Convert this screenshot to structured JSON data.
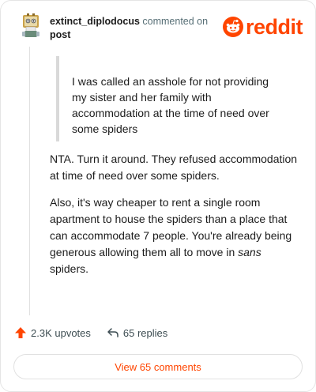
{
  "header": {
    "username": "extinct_diplodocus",
    "action": "commented on",
    "post_link": "post",
    "logo_text": "reddit"
  },
  "quote": {
    "text": "I was called an asshole for not providing my sister and her family with accommodation at the time of need over some spiders"
  },
  "comment": {
    "paragraph_1": "NTA. Turn it around. They refused accommodation at time of need over some spiders.",
    "paragraph_2_before": "Also, it's way cheaper to rent a single room apartment to house the spiders than a place that can accommodate 7 people. You're already being generous allowing them all to move in ",
    "paragraph_2_em": "sans",
    "paragraph_2_after": " spiders."
  },
  "footer": {
    "upvotes": "2.3K upvotes",
    "replies": "65 replies",
    "view_button": "View 65 comments"
  },
  "colors": {
    "brand": "#ff4500",
    "upvote_arrow": "#ff4500",
    "muted_text": "#576f76"
  },
  "icons": {
    "avatar": "snoo-avatar-icon",
    "logo": "reddit-snoo-icon",
    "upvote": "upvote-arrow-icon",
    "reply": "reply-arrow-icon"
  }
}
